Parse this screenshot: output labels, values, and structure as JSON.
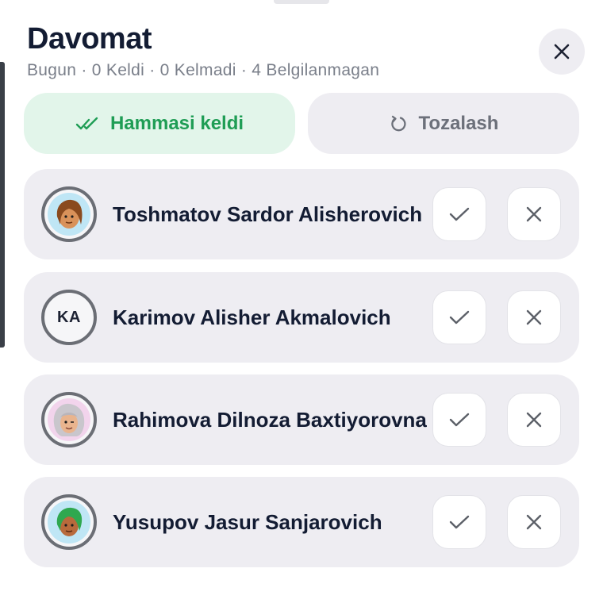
{
  "header": {
    "title": "Davomat",
    "subtitle": "Bugun · 0 Keldi · 0 Kelmadi · 4 Belgilanmagan"
  },
  "actions": {
    "all_present_label": "Hammasi keldi",
    "reset_label": "Tozalash"
  },
  "colors": {
    "accent_green": "#1f9d55",
    "accent_green_bg": "#e2f5ea",
    "row_bg": "#eeedf2",
    "title_text": "#131c33"
  },
  "students": [
    {
      "name": "Toshmatov Sardor Alisherovich",
      "avatar": "avatar-icon-brown-hair"
    },
    {
      "name": "Karimov Alisher Akmalovich",
      "initials": "KA"
    },
    {
      "name": "Rahimova Dilnoza Baxtiyorovna",
      "avatar": "avatar-icon-gray-hair"
    },
    {
      "name": "Yusupov Jasur Sanjarovich",
      "avatar": "avatar-icon-green-hair"
    }
  ]
}
